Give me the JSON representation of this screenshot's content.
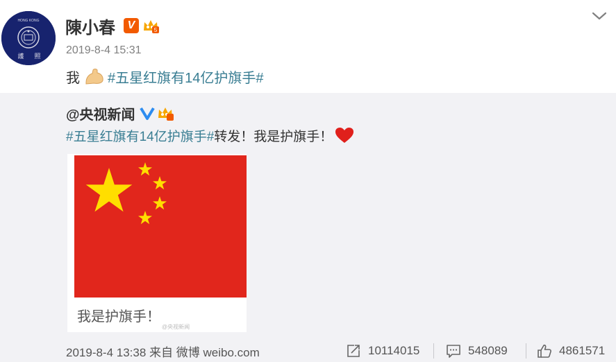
{
  "post": {
    "author": "陳小春",
    "time": "2019-8-4 15:31",
    "text_prefix": "我",
    "topic": "#五星红旗有14亿护旗手#",
    "avatar_text_top": "HONG KONG",
    "avatar_text_bottom_left": "護",
    "avatar_text_bottom_right": "照"
  },
  "repost": {
    "author": "@央视新闻",
    "topic": "#五星红旗有14亿护旗手#",
    "text": "转发！我是护旗手！",
    "image_caption": "我是护旗手！",
    "image_watermark": "@央视新闻"
  },
  "footer": {
    "time_source": "2019-8-4 13:38 来自 微博 weibo.com",
    "reposts": "10114015",
    "comments": "548089",
    "likes": "4861571"
  },
  "colors": {
    "topic_link": "#3a7e93",
    "flag_red": "#e1261c",
    "flag_yellow": "#ffde00",
    "repost_bg": "#f2f2f5"
  },
  "icons": [
    "chevron-down-icon",
    "verified-v-icon",
    "vip-crown-icon",
    "flexed-biceps-emoji",
    "heart-emoji",
    "repost-icon",
    "comment-icon",
    "like-icon"
  ]
}
